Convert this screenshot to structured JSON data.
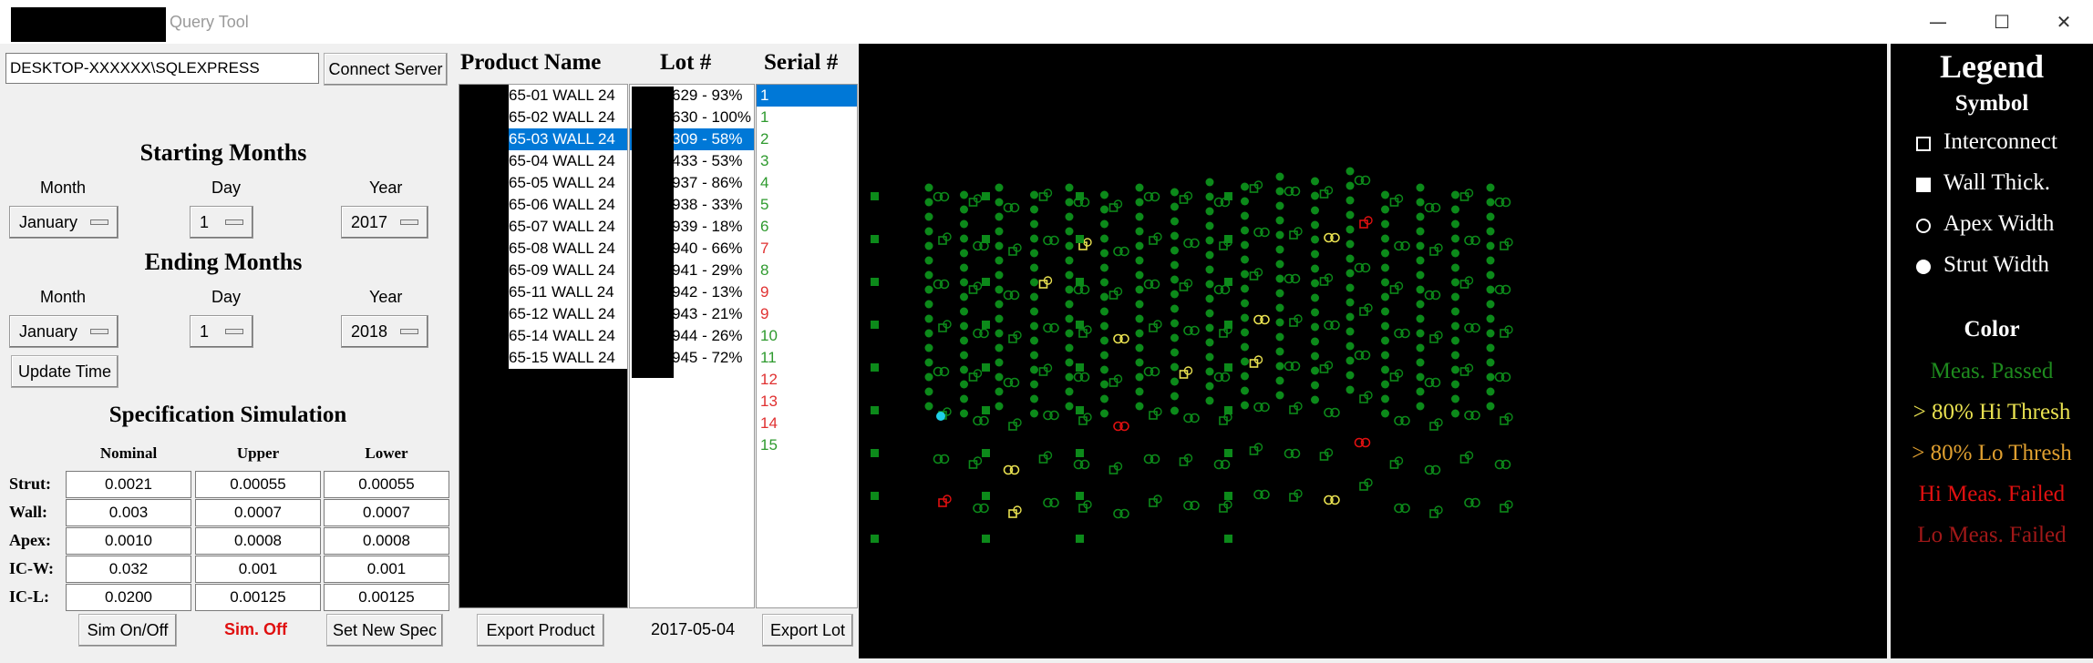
{
  "window": {
    "title": "Query Tool",
    "controls": [
      "minimize-icon",
      "maximize-icon",
      "close-icon"
    ]
  },
  "server": {
    "value": "DESKTOP-XXXXXX\\SQLEXPRESS",
    "connect_label": "Connect Server"
  },
  "starting": {
    "heading": "Starting Months",
    "month_label": "Month",
    "day_label": "Day",
    "year_label": "Year",
    "month": "January",
    "day": "1",
    "year": "2017"
  },
  "ending": {
    "heading": "Ending Months",
    "month_label": "Month",
    "day_label": "Day",
    "year_label": "Year",
    "month": "January",
    "day": "1",
    "year": "2018"
  },
  "update_time_label": "Update Time",
  "spec": {
    "heading": "Specification Simulation",
    "columns": [
      "Nominal",
      "Upper",
      "Lower"
    ],
    "rows": [
      {
        "label": "Strut:",
        "values": [
          "0.0021",
          "0.00055",
          "0.00055"
        ]
      },
      {
        "label": "Wall:",
        "values": [
          "0.003",
          "0.0007",
          "0.0007"
        ]
      },
      {
        "label": "Apex:",
        "values": [
          "0.0010",
          "0.0008",
          "0.0008"
        ]
      },
      {
        "label": "IC-W:",
        "values": [
          "0.032",
          "0.001",
          "0.001"
        ]
      },
      {
        "label": "IC-L:",
        "values": [
          "0.0200",
          "0.00125",
          "0.00125"
        ]
      }
    ],
    "sim_toggle_label": "Sim On/Off",
    "sim_status": "Sim. Off",
    "set_spec_label": "Set New Spec"
  },
  "product": {
    "header": "Product Name",
    "items": [
      "65-01 WALL 24",
      "65-02 WALL 24",
      "65-03 WALL 24",
      "65-04 WALL 24",
      "65-05 WALL 24",
      "65-06 WALL 24",
      "65-07 WALL 24",
      "65-08 WALL 24",
      "65-09 WALL 24",
      "65-11 WALL 24",
      "65-12 WALL 24",
      "65-14 WALL 24",
      "65-15 WALL 24"
    ],
    "selected_index": 2,
    "export_label": "Export Product"
  },
  "lot": {
    "header": "Lot #",
    "items": [
      "629 - 93%",
      "630 - 100%",
      "309 - 58%",
      "433 - 53%",
      "937 - 86%",
      "938 - 33%",
      "939 - 18%",
      "940 - 66%",
      "941 - 29%",
      "942 - 13%",
      "943 - 21%",
      "944 - 26%",
      "945 - 72%"
    ],
    "selected_index": 2,
    "date": "2017-05-04",
    "export_label": "Export Lot"
  },
  "serial": {
    "header": "Serial #",
    "items": [
      {
        "label": "1",
        "color": "#ffffff"
      },
      {
        "label": "1",
        "color": "#2e9a2e"
      },
      {
        "label": "2",
        "color": "#2e9a2e"
      },
      {
        "label": "3",
        "color": "#2e9a2e"
      },
      {
        "label": "4",
        "color": "#2e9a2e"
      },
      {
        "label": "5",
        "color": "#2e9a2e"
      },
      {
        "label": "6",
        "color": "#2e9a2e"
      },
      {
        "label": "7",
        "color": "#e03030"
      },
      {
        "label": "8",
        "color": "#2e9a2e"
      },
      {
        "label": "9",
        "color": "#e03030"
      },
      {
        "label": "9",
        "color": "#e03030"
      },
      {
        "label": "10",
        "color": "#2e9a2e"
      },
      {
        "label": "11",
        "color": "#2e9a2e"
      },
      {
        "label": "12",
        "color": "#e03030"
      },
      {
        "label": "13",
        "color": "#e03030"
      },
      {
        "label": "14",
        "color": "#e03030"
      },
      {
        "label": "15",
        "color": "#2e9a2e"
      }
    ],
    "selected_index": 0
  },
  "legend": {
    "title": "Legend",
    "symbol_heading": "Symbol",
    "symbols": [
      {
        "label": "Interconnect",
        "icon": "open-square-icon"
      },
      {
        "label": "Wall Thick.",
        "icon": "filled-square-icon"
      },
      {
        "label": "Apex Width",
        "icon": "open-circle-icon"
      },
      {
        "label": "Strut Width",
        "icon": "filled-circle-icon"
      }
    ],
    "color_heading": "Color",
    "colors": [
      {
        "label": "Meas. Passed",
        "color": "#1e8a1e"
      },
      {
        "label": "> 80% Hi Thresh",
        "color": "#e8e050"
      },
      {
        "label": "> 80% Lo Thresh",
        "color": "#e0a030"
      },
      {
        "label": "Hi Meas. Failed",
        "color": "#e01010"
      },
      {
        "label": "Lo Meas. Failed",
        "color": "#a01818"
      }
    ]
  },
  "plot_colors": {
    "pass": "#0c8a1a",
    "hi80": "#e8e050",
    "hifail": "#e01010",
    "highlight": "#20d0e8"
  }
}
